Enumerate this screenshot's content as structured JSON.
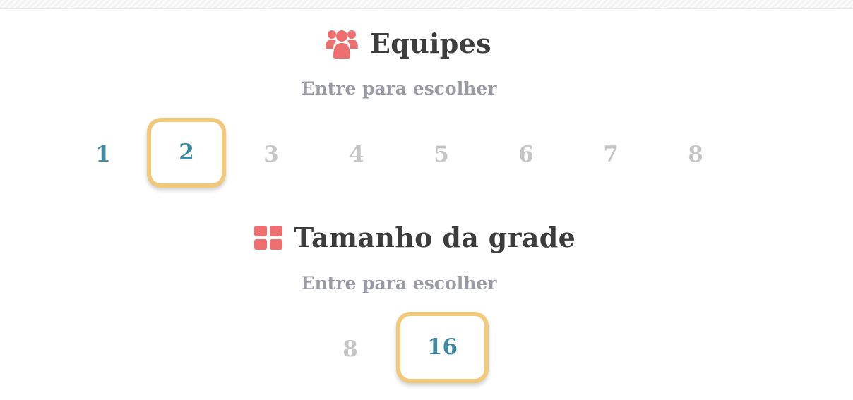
{
  "teams_section": {
    "title": "Equipes",
    "icon": "users-group-icon",
    "subtitle": "Entre para escolher",
    "options": [
      "1",
      "2",
      "3",
      "4",
      "5",
      "6",
      "7",
      "8"
    ],
    "selected": "2"
  },
  "grid_section": {
    "title": "Tamanho da grade",
    "icon": "grid-icon",
    "subtitle": "Entre para escolher",
    "options": [
      "8",
      "16"
    ],
    "selected": "16"
  },
  "colors": {
    "icon": "#ee6f6f",
    "title": "#3d3d3d",
    "subtitle": "#999aa4",
    "active_option": "#3f8aa0",
    "inactive_option": "#c5c5c5",
    "selection_border": "#f0c97a"
  }
}
